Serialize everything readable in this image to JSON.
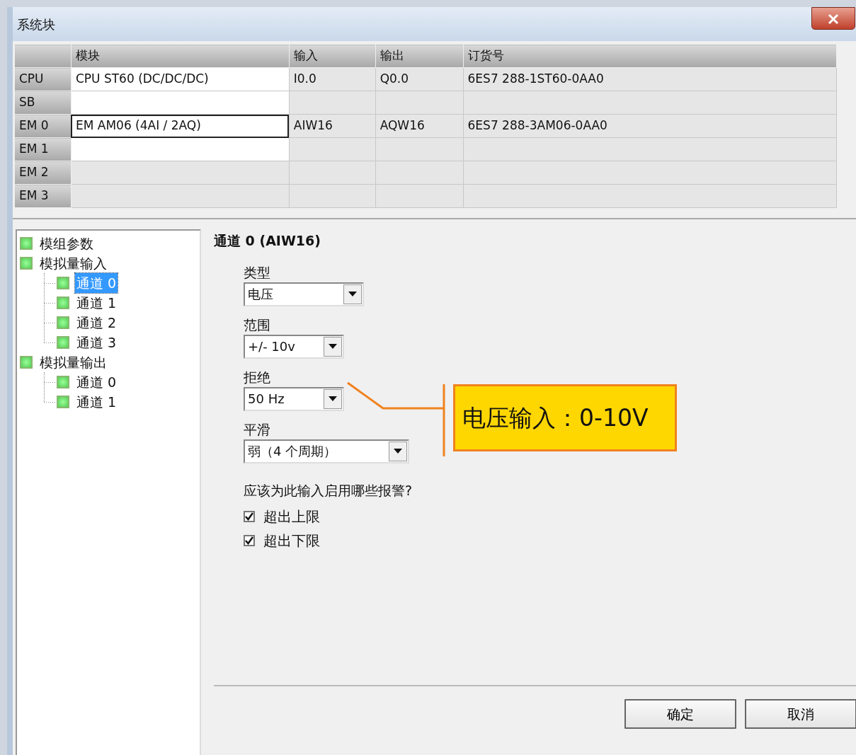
{
  "window": {
    "title": "系统块"
  },
  "table": {
    "columns": [
      "",
      "模块",
      "输入",
      "输出",
      "订货号"
    ],
    "rows": [
      {
        "slot": "CPU",
        "module": "CPU ST60 (DC/DC/DC)",
        "input": "I0.0",
        "output": "Q0.0",
        "order_number": "6ES7 288-1ST60-0AA0",
        "editable": true,
        "selected": false
      },
      {
        "slot": "SB",
        "module": "",
        "input": "",
        "output": "",
        "order_number": "",
        "editable": true,
        "selected": false
      },
      {
        "slot": "EM 0",
        "module": "EM AM06 (4AI / 2AQ)",
        "input": "AIW16",
        "output": "AQW16",
        "order_number": "6ES7 288-3AM06-0AA0",
        "editable": true,
        "selected": true
      },
      {
        "slot": "EM 1",
        "module": "",
        "input": "",
        "output": "",
        "order_number": "",
        "editable": true,
        "selected": false
      },
      {
        "slot": "EM 2",
        "module": "",
        "input": "",
        "output": "",
        "order_number": "",
        "editable": false,
        "selected": false
      },
      {
        "slot": "EM 3",
        "module": "",
        "input": "",
        "output": "",
        "order_number": "",
        "editable": false,
        "selected": false
      }
    ]
  },
  "tree": [
    {
      "label": "模组参数",
      "selected": false
    },
    {
      "label": "模拟量输入",
      "selected": false,
      "children": [
        {
          "label": "通道 0",
          "selected": true
        },
        {
          "label": "通道 1",
          "selected": false
        },
        {
          "label": "通道 2",
          "selected": false
        },
        {
          "label": "通道 3",
          "selected": false
        }
      ]
    },
    {
      "label": "模拟量输出",
      "selected": false,
      "children": [
        {
          "label": "通道 0",
          "selected": false
        },
        {
          "label": "通道 1",
          "selected": false
        }
      ]
    }
  ],
  "panel": {
    "heading": "通道 0 (AIW16)",
    "fields": [
      {
        "label": "类型",
        "value": "电压"
      },
      {
        "label": "范围",
        "value": "+/- 10v"
      },
      {
        "label": "拒绝",
        "value": "50 Hz"
      },
      {
        "label": "平滑",
        "value": "弱（4 个周期）"
      }
    ],
    "alarms_question": "应该为此输入启用哪些报警?",
    "alarms": [
      {
        "label": "超出上限",
        "checked": true
      },
      {
        "label": "超出下限",
        "checked": true
      }
    ]
  },
  "callout": {
    "text": "电压输入：0-10V"
  },
  "buttons": [
    "确定",
    "取消"
  ]
}
